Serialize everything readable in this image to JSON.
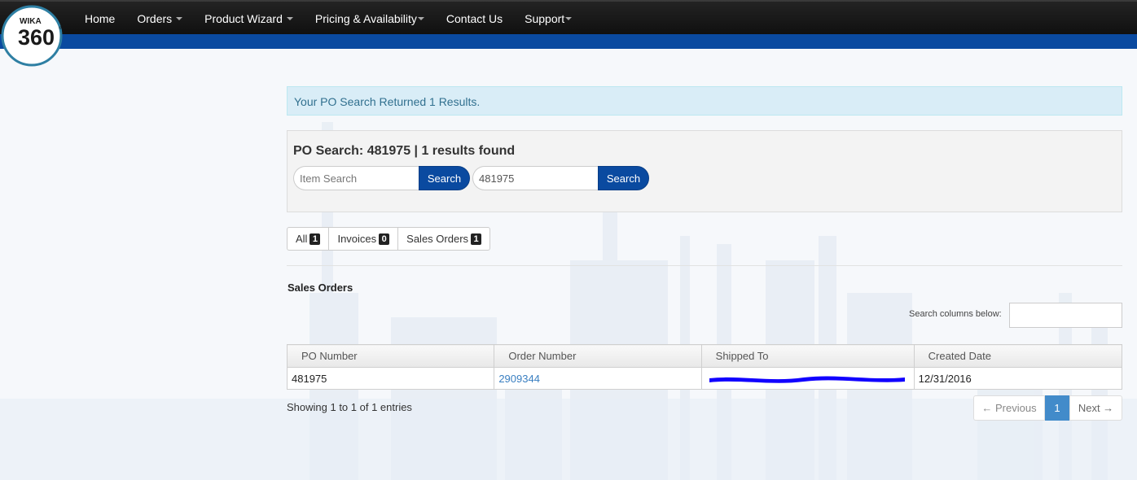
{
  "brand": {
    "logo_small": "WIKA",
    "logo_big": "360",
    "degree": "°"
  },
  "nav": {
    "items": [
      {
        "label": "Home",
        "dropdown": false
      },
      {
        "label": "Orders",
        "dropdown": true
      },
      {
        "label": "Product Wizard",
        "dropdown": true
      },
      {
        "label": "Pricing & Availability",
        "dropdown": true
      },
      {
        "label": "Contact Us",
        "dropdown": false
      },
      {
        "label": "Support",
        "dropdown": true
      }
    ]
  },
  "alert": {
    "text": "Your PO Search Returned 1 Results."
  },
  "search_panel": {
    "title": "PO Search: 481975 | 1 results found",
    "item_search": {
      "placeholder": "Item Search",
      "value": "",
      "button": "Search"
    },
    "po_search": {
      "placeholder": "",
      "value": "481975",
      "button": "Search"
    }
  },
  "filters": [
    {
      "label": "All",
      "count": "1"
    },
    {
      "label": "Invoices",
      "count": "0"
    },
    {
      "label": "Sales Orders",
      "count": "1"
    }
  ],
  "section": {
    "title": "Sales Orders"
  },
  "column_search": {
    "label": "Search columns below:",
    "value": ""
  },
  "table": {
    "headers": [
      "PO Number",
      "Order Number",
      "Shipped To",
      "Created Date"
    ],
    "rows": [
      {
        "po_number": "481975",
        "order_number": "2909344",
        "shipped_to": "",
        "created_date": "12/31/2016"
      }
    ]
  },
  "footer": {
    "showing": "Showing 1 to 1 of 1 entries",
    "pagination": {
      "previous": "← Previous",
      "page": "1",
      "next": "Next →"
    }
  },
  "colors": {
    "nav_bg": "#141414",
    "brand_blue": "#0a4aa0",
    "alert_bg": "#d9edf7",
    "link": "#3a7fc1",
    "redaction": "#1100ff"
  }
}
